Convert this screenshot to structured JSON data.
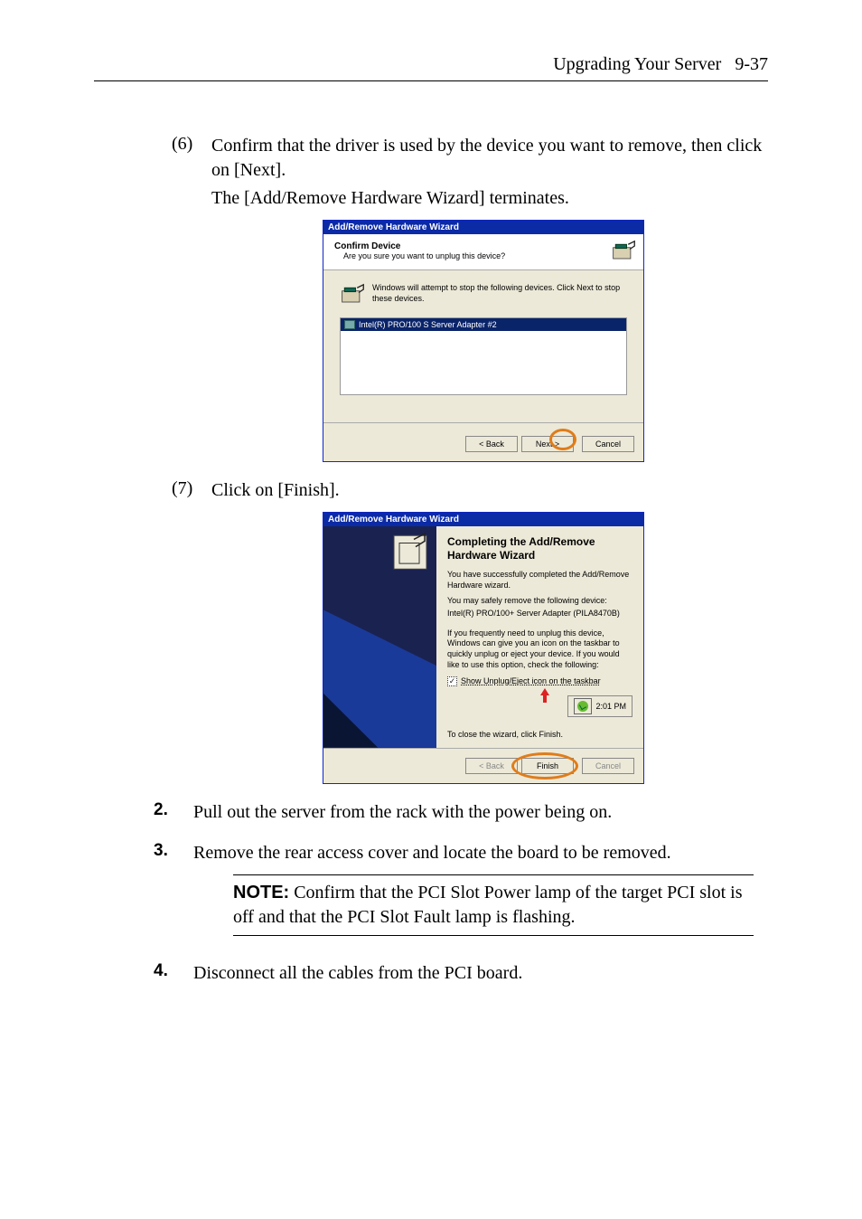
{
  "header": {
    "title": "Upgrading Your Server",
    "page": "9-37"
  },
  "steps": {
    "s6": {
      "num": "(6)",
      "text": "Confirm that the driver is used by the device you want to remove, then click on [Next].",
      "line2": "The [Add/Remove Hardware Wizard] terminates."
    },
    "s7": {
      "num": "(7)",
      "text": "Click on [Finish]."
    },
    "s2": {
      "num": "2.",
      "text": "Pull out the server from the rack with the power being on."
    },
    "s3": {
      "num": "3.",
      "text": "Remove the rear access cover and locate the board to be removed."
    },
    "s4": {
      "num": "4.",
      "text": "Disconnect all the cables from the PCI board."
    }
  },
  "note": {
    "label": "NOTE:",
    "text": " Confirm that the PCI Slot Power lamp of the target PCI slot is off and that the PCI Slot Fault lamp is flashing."
  },
  "wizard1": {
    "title": "Add/Remove Hardware Wizard",
    "heading": "Confirm Device",
    "sub": "Are you sure you want to unplug this device?",
    "midtext": "Windows will attempt to stop the following devices.  Click Next to stop these devices.",
    "device": "Intel(R) PRO/100 S Server Adapter #2",
    "back": "< Back",
    "next": "Next >",
    "cancel": "Cancel"
  },
  "wizard2": {
    "title": "Add/Remove Hardware Wizard",
    "heading": "Completing the Add/Remove Hardware Wizard",
    "l1": "You have successfully completed the Add/Remove Hardware wizard.",
    "l2a": "You may safely remove the following device:",
    "l2b": "Intel(R) PRO/100+ Server Adapter (PILA8470B)",
    "l3": "If you frequently need to unplug this device, Windows can give you an icon on the taskbar to quickly unplug or eject your device. If you would like to use this option, check the following:",
    "chk": "Show Unplug/Eject icon on the taskbar",
    "time": "2:01 PM",
    "close": "To close the wizard, click Finish.",
    "back": "< Back",
    "finish": "Finish",
    "cancel": "Cancel"
  }
}
